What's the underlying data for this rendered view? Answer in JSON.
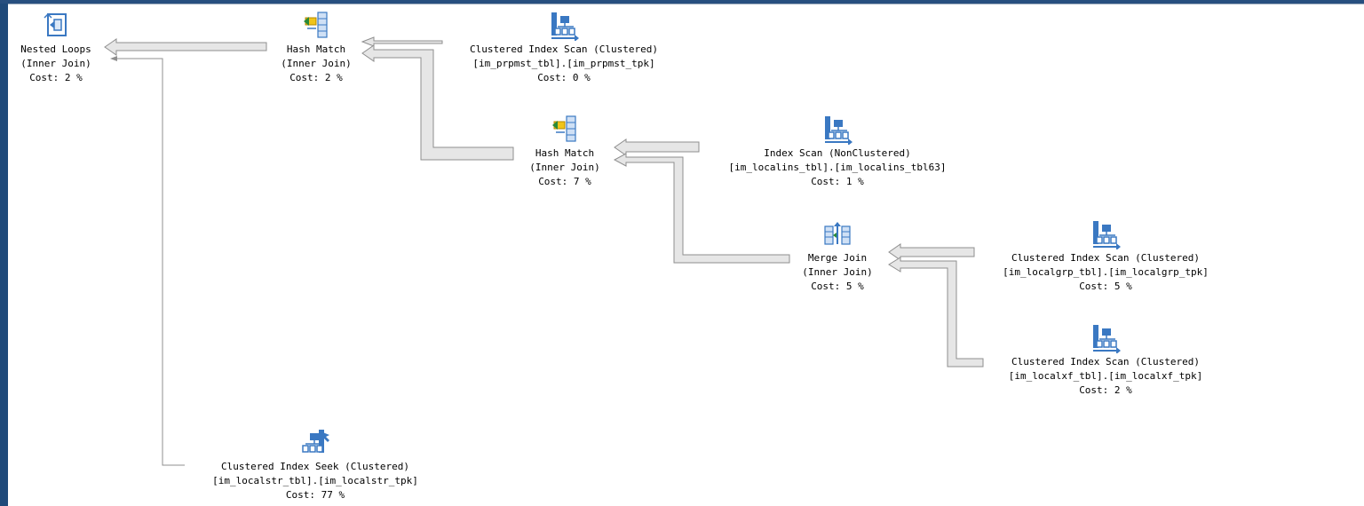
{
  "frame": {
    "border_color": "#1f4a7a",
    "background": "#ffffff",
    "arrow_fill": "#e6e6e6",
    "arrow_stroke": "#8f8f8f",
    "icon_blue": "#3a78c2",
    "icon_yellow": "#f0c419"
  },
  "nodes": [
    {
      "id": "nested-loops",
      "icon": "nested-loops-icon",
      "line1": "Nested Loops",
      "line2": "(Inner Join)",
      "cost": "Cost: 2 %"
    },
    {
      "id": "hash-match-1",
      "icon": "hash-match-icon",
      "line1": "Hash Match",
      "line2": "(Inner Join)",
      "cost": "Cost: 2 %"
    },
    {
      "id": "clustered-scan-prpmst",
      "icon": "clustered-index-scan-icon",
      "line1": "Clustered Index Scan (Clustered)",
      "line2": "[im_prpmst_tbl].[im_prpmst_tpk]",
      "cost": "Cost: 0 %"
    },
    {
      "id": "hash-match-2",
      "icon": "hash-match-icon",
      "line1": "Hash Match",
      "line2": "(Inner Join)",
      "cost": "Cost: 7 %"
    },
    {
      "id": "index-scan-localins",
      "icon": "index-scan-icon",
      "line1": "Index Scan (NonClustered)",
      "line2": "[im_localins_tbl].[im_localins_tbl63]",
      "cost": "Cost: 1 %"
    },
    {
      "id": "merge-join",
      "icon": "merge-join-icon",
      "line1": "Merge Join",
      "line2": "(Inner Join)",
      "cost": "Cost: 5 %"
    },
    {
      "id": "clustered-scan-localgrp",
      "icon": "clustered-index-scan-icon",
      "line1": "Clustered Index Scan (Clustered)",
      "line2": "[im_localgrp_tbl].[im_localgrp_tpk]",
      "cost": "Cost: 5 %"
    },
    {
      "id": "clustered-scan-localxf",
      "icon": "clustered-index-scan-icon",
      "line1": "Clustered Index Scan (Clustered)",
      "line2": "[im_localxf_tbl].[im_localxf_tpk]",
      "cost": "Cost: 2 %"
    },
    {
      "id": "clustered-seek-localstr",
      "icon": "clustered-index-seek-icon",
      "line1": "Clustered Index Seek (Clustered)",
      "line2": "[im_localstr_tbl].[im_localstr_tpk]",
      "cost": "Cost: 77 %"
    }
  ]
}
